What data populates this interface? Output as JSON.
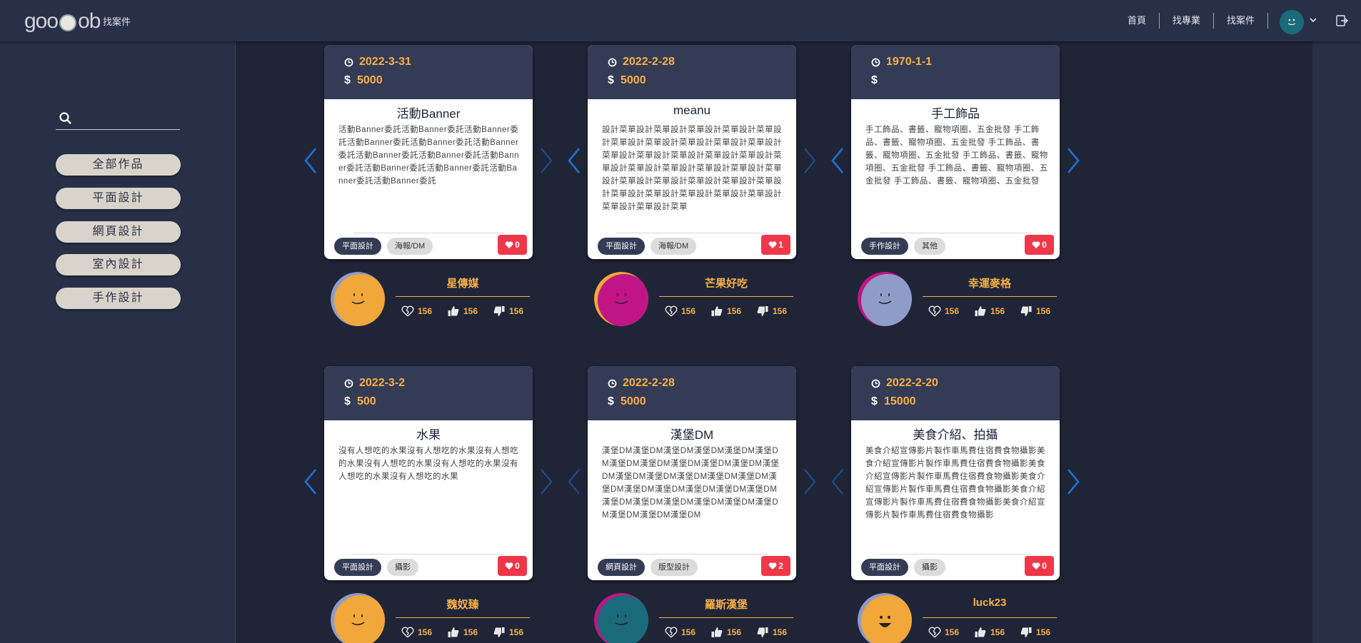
{
  "header": {
    "logo_left": "goo",
    "logo_right": "ob",
    "find_case": "找案件",
    "nav": [
      "首頁",
      "找專業",
      "找案件"
    ]
  },
  "search": {
    "placeholder": ""
  },
  "categories": [
    "全部作品",
    "平面設計",
    "網頁設計",
    "室內設計",
    "手作設計"
  ],
  "cards": [
    {
      "date": "2022-3-31",
      "price": "5000",
      "title": "活動Banner",
      "desc": "活動Banner委託活動Banner委託活動Banner委託活動Banner委託活動Banner委託活動Banner委託活動Banner委託活動Banner委託活動Banner委託活動Banner委託活動Banner委託活動Banner委託活動Banner委託",
      "tags": [
        "平面設計",
        "海報/DM"
      ],
      "likes": "0",
      "user": "星傳媒",
      "stats": [
        "156",
        "156",
        "156"
      ]
    },
    {
      "date": "2022-2-28",
      "price": "5000",
      "title": "meanu",
      "desc": "設計菜單設計菜單設計菜單設計菜單設計菜單設計菜單設計菜單設計菜單設計菜單設計菜單設計菜單設計菜單設計菜單設計菜單設計菜單設計菜單設計菜單設計菜單設計菜單設計菜單設計菜單設計菜單設計菜單設計菜單設計菜單設計菜單設計菜單設計菜單設計菜單設計菜單設計菜單設計菜單設計菜單設計菜單",
      "tags": [
        "平面設計",
        "海報/DM"
      ],
      "likes": "1",
      "user": "芒果好吃",
      "stats": [
        "156",
        "156",
        "156"
      ]
    },
    {
      "date": "1970-1-1",
      "price": "",
      "title": "手工飾品",
      "desc": "手工飾品、書籤、寵物項圈、五金批發 手工飾品、書籤、寵物項圈、五金批發 手工飾品、書籤、寵物項圈、五金批發 手工飾品、書籤、寵物項圈、五金批發 手工飾品、書籤、寵物項圈、五金批發 手工飾品、書籤、寵物項圈、五金批發",
      "tags": [
        "手作設計",
        "其他"
      ],
      "likes": "0",
      "user": "幸運麥格",
      "stats": [
        "156",
        "156",
        "156"
      ]
    },
    {
      "date": "2022-3-2",
      "price": "500",
      "title": "水果",
      "desc": "沒有人想吃的水果沒有人想吃的水果沒有人想吃的水果沒有人想吃的水果沒有人想吃的水果沒有人想吃的水果沒有人想吃的水果",
      "tags": [
        "平面設計",
        "攝影"
      ],
      "likes": "0",
      "user": "魏奴臻",
      "stats": [
        "156",
        "156",
        "156"
      ]
    },
    {
      "date": "2022-2-28",
      "price": "5000",
      "title": "漢堡DM",
      "desc": "漢堡DM漢堡DM漢堡DM漢堡DM漢堡DM漢堡DM漢堡DM漢堡DM漢堡DM漢堡DM漢堡DM漢堡DM漢堡DM漢堡DM漢堡DM漢堡DM漢堡DM漢堡DM漢堡DM漢堡DM漢堡DM漢堡DM漢堡DM漢堡DM漢堡DM漢堡DM漢堡DM漢堡DM漢堡DM漢堡DM漢堡DM漢堡DM",
      "tags": [
        "網頁設計",
        "版型設計"
      ],
      "likes": "2",
      "user": "羅斯漢堡",
      "stats": [
        "156",
        "156",
        "156"
      ]
    },
    {
      "date": "2022-2-20",
      "price": "15000",
      "title": "美食介紹、拍攝",
      "desc": "美食介紹宣傳影片製作車馬費住宿費食物攝影美食介紹宣傳影片製作車馬費住宿費食物攝影美食介紹宣傳影片製作車馬費住宿費食物攝影美食介紹宣傳影片製作車馬費住宿費食物攝影美食介紹宣傳影片製作車馬費住宿費食物攝影美食介紹宣傳影片製作車馬費住宿費食物攝影",
      "tags": [
        "平面設計",
        "攝影"
      ],
      "likes": "0",
      "user": "luck23",
      "stats": [
        "156",
        "156",
        "156"
      ]
    }
  ],
  "colors": {
    "accent": "#f6b046",
    "heart": "#f0374a",
    "arrow": "#1f6fd1",
    "header": "#283047",
    "background": "#1f2537"
  },
  "avatars": [
    {
      "fill": "#f2a73a",
      "accent": "#8e9bc9",
      "face": "smile-line"
    },
    {
      "fill": "#c11586",
      "accent": "#f2a73a",
      "face": "smile-line"
    },
    {
      "fill": "#8f9cc8",
      "accent": "#c11586",
      "face": "smile-line"
    },
    {
      "fill": "#f2a73a",
      "accent": "#8e9bc9",
      "face": "smile-line"
    },
    {
      "fill": "#1a6a7a",
      "accent": "#c11586",
      "face": "smile-line"
    },
    {
      "fill": "#f2a73a",
      "accent": "#8e9bc9",
      "face": "open-smile"
    }
  ]
}
